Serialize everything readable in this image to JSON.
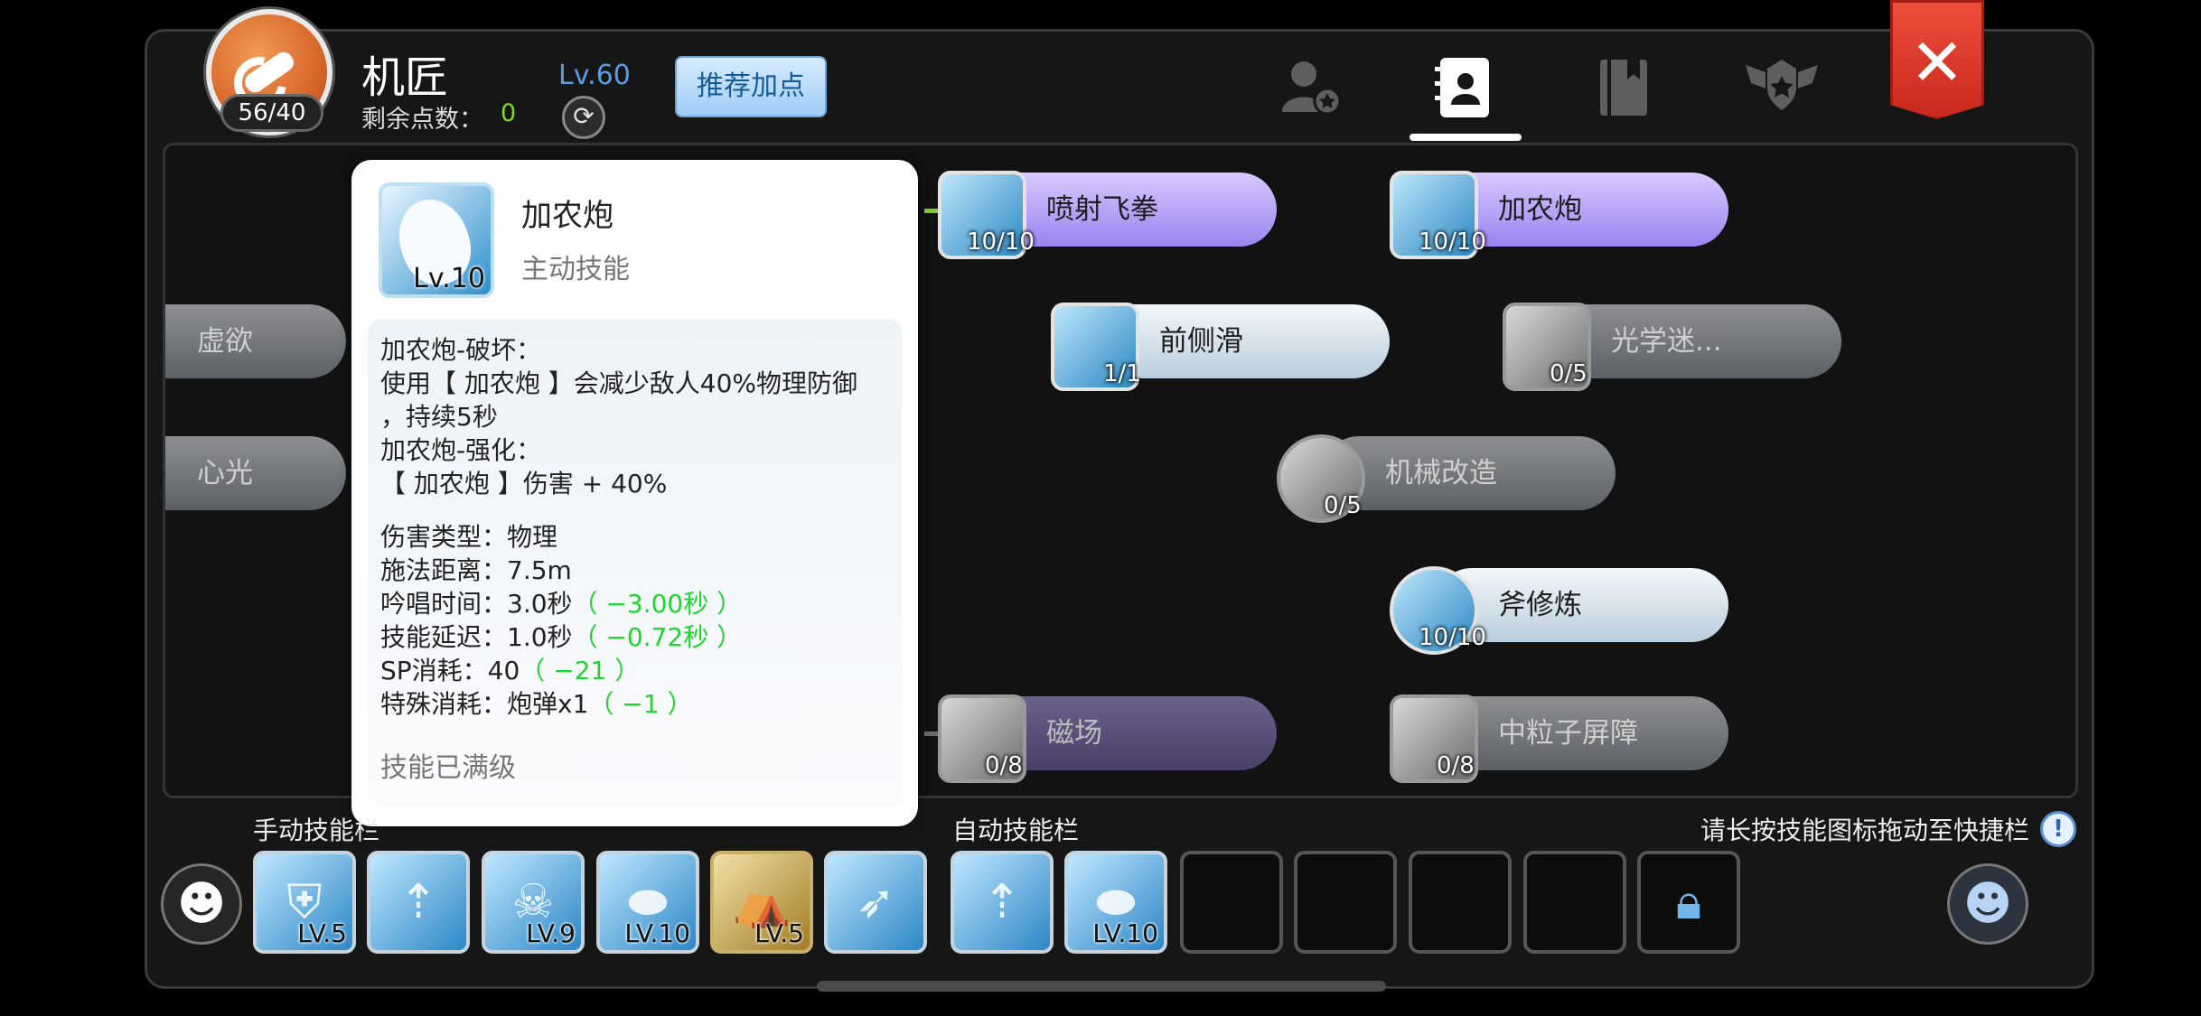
{
  "header": {
    "class_name": "机匠",
    "skill_count": "56/40",
    "points_label": "剩余点数：",
    "points_value": "0",
    "level": "Lv.60",
    "recommend_label": "推荐加点",
    "refresh_icon": "refresh-icon",
    "close_icon": "close-icon",
    "tabs": [
      {
        "name": "profile",
        "icon": "person-star-icon"
      },
      {
        "name": "skills",
        "icon": "contact-book-icon",
        "active": true
      },
      {
        "name": "book",
        "icon": "book-icon"
      },
      {
        "name": "badge",
        "icon": "winged-crest-icon"
      }
    ]
  },
  "tree": {
    "left_partial": [
      "虚欲",
      "心光"
    ],
    "nodes": [
      {
        "label": "喷射飞拳",
        "count": "10/10"
      },
      {
        "label": "加农炮",
        "count": "10/10"
      },
      {
        "label": "前侧滑",
        "count": "1/1"
      },
      {
        "label": "光学迷...",
        "count": "0/5"
      },
      {
        "label": "机械改造",
        "count": "0/5"
      },
      {
        "label": "斧修炼",
        "count": "10/10"
      },
      {
        "label": "磁场",
        "count": "0/8"
      },
      {
        "label": "中粒子屏障",
        "count": "0/8"
      }
    ]
  },
  "tooltip": {
    "title": "加农炮",
    "type": "主动技能",
    "level": "Lv.10",
    "line1": "加农炮-破坏：",
    "line2": "使用【 加农炮 】会减少敌人40%物理防御",
    "line3": "，持续5秒",
    "line4": "加农炮-强化：",
    "line5": "【 加农炮 】伤害 + 40%",
    "damage_type": "伤害类型：物理",
    "range": "施法距离：7.5m",
    "cast_time": "吟唱时间：3.0秒",
    "cast_time_mod": "（ −3.00秒 ）",
    "delay": "技能延迟：1.0秒",
    "delay_mod": "（ −0.72秒 ）",
    "sp": "SP消耗：40",
    "sp_mod": "（ −21 ）",
    "special": "特殊消耗：炮弹x1",
    "special_mod": "（ −1 ）",
    "status": "技能已满级"
  },
  "bottom": {
    "manual_label": "手动技能栏",
    "auto_label": "自动技能栏",
    "hint": "请长按技能图标拖动至快捷栏",
    "hint_icon": "info-icon",
    "manual_slots": [
      {
        "level": "LV.5",
        "icon": "mech-armor-icon"
      },
      {
        "level": "",
        "icon": "fountain-icon"
      },
      {
        "level": "LV.9",
        "icon": "skull-sparkle-icon"
      },
      {
        "level": "LV.10",
        "icon": "cannon-shell-icon"
      },
      {
        "level": "LV.5",
        "icon": "tent-icon"
      },
      {
        "level": "",
        "icon": "rocket-dash-icon"
      }
    ],
    "auto_slots": [
      {
        "level": "",
        "icon": "fountain-icon"
      },
      {
        "level": "LV.10",
        "icon": "cannon-shell-icon"
      }
    ],
    "lock_icon": "lock-icon"
  },
  "colors": {
    "accent_green": "#7ccd2b",
    "modifier_green": "#1fd630",
    "close_red": "#d9352a",
    "level_blue": "#5b9de0"
  }
}
